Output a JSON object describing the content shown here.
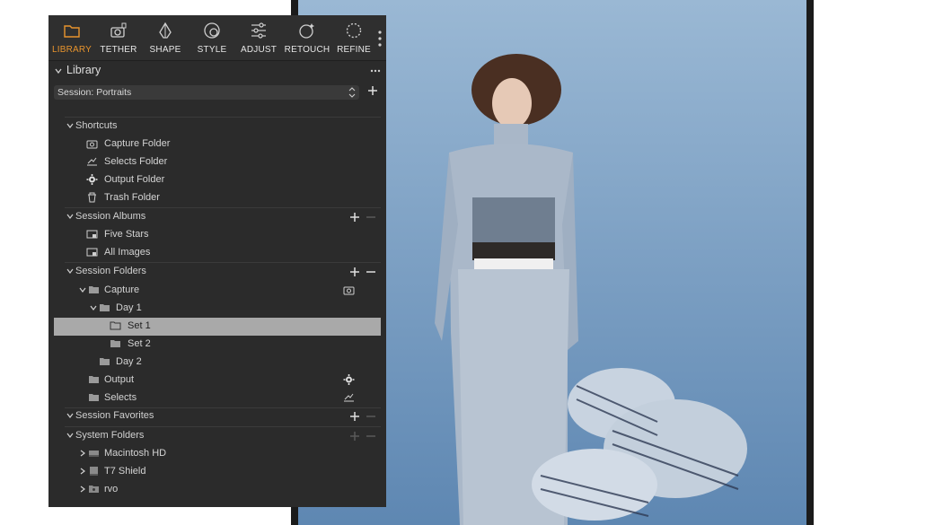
{
  "toolbar": {
    "tabs": [
      {
        "label": "LIBRARY",
        "icon": "folder-icon",
        "active": true
      },
      {
        "label": "TETHER",
        "icon": "camera-icon",
        "active": false
      },
      {
        "label": "SHAPE",
        "icon": "shape-icon",
        "active": false
      },
      {
        "label": "STYLE",
        "icon": "style-icon",
        "active": false
      },
      {
        "label": "ADJUST",
        "icon": "sliders-icon",
        "active": false
      },
      {
        "label": "RETOUCH",
        "icon": "retouch-icon",
        "active": false
      },
      {
        "label": "REFINE",
        "icon": "refine-icon",
        "active": false
      }
    ]
  },
  "library": {
    "title": "Library",
    "session_select": "Session: Portraits"
  },
  "tree": {
    "shortcuts": {
      "label": "Shortcuts",
      "items": [
        "Capture Folder",
        "Selects Folder",
        "Output Folder",
        "Trash Folder"
      ]
    },
    "session_albums": {
      "label": "Session Albums",
      "items": [
        "Five Stars",
        "All Images"
      ]
    },
    "session_folders": {
      "label": "Session Folders",
      "capture": "Capture",
      "day1": "Day 1",
      "set1": "Set 1",
      "set2": "Set 2",
      "day2": "Day 2",
      "output": "Output",
      "selects": "Selects"
    },
    "session_favorites": {
      "label": "Session Favorites"
    },
    "system_folders": {
      "label": "System Folders",
      "items": [
        "Macintosh HD",
        "T7 Shield",
        "rvo"
      ]
    }
  },
  "colors": {
    "accent": "#e8942d",
    "panel_bg": "#2b2b2b",
    "selected_row": "#a9a9a9"
  }
}
